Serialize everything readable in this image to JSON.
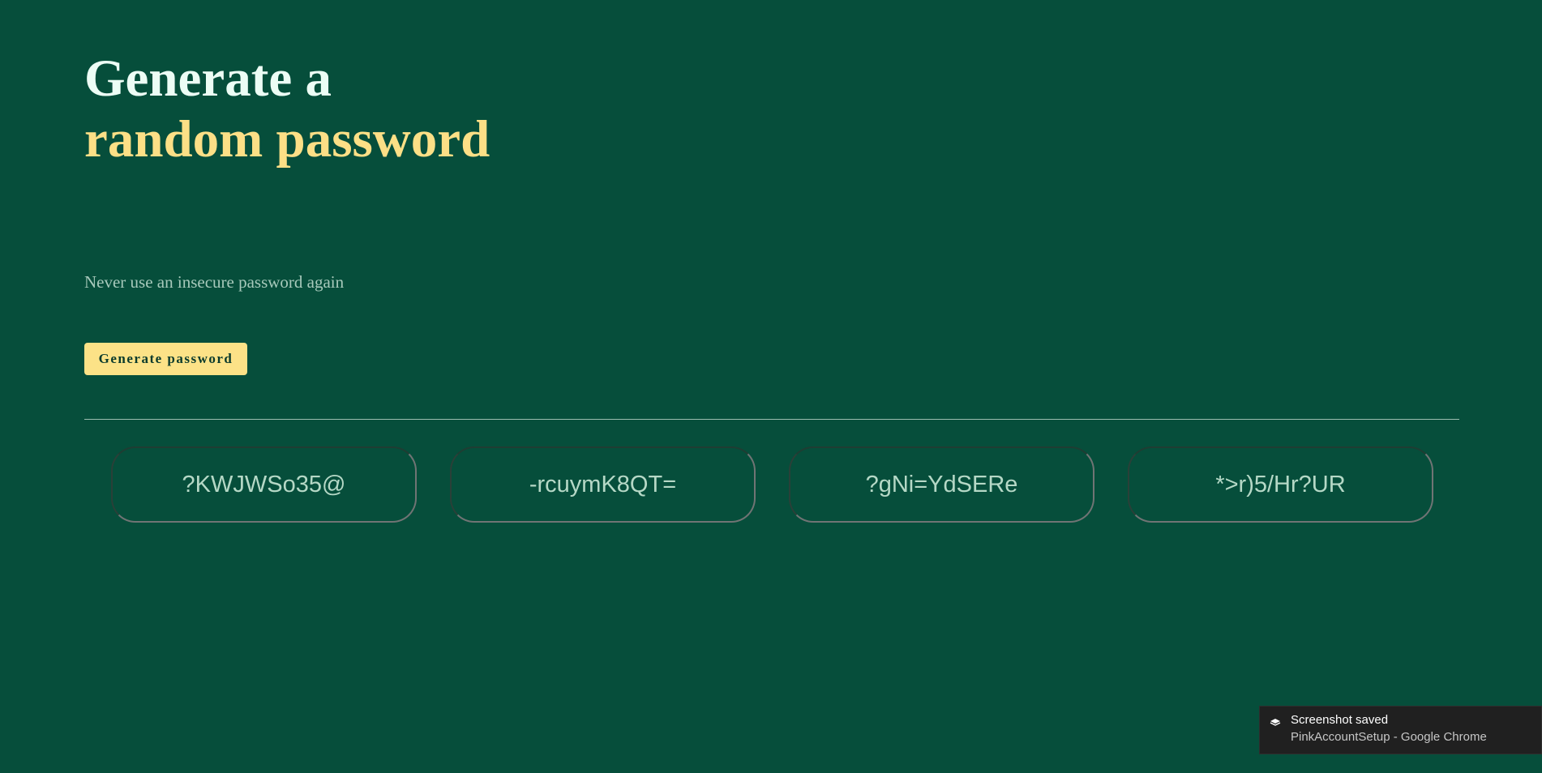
{
  "header": {
    "title_line1": "Generate a",
    "title_line2": "random password",
    "subtitle": "Never use an insecure password again"
  },
  "actions": {
    "generate_label": "Generate password"
  },
  "passwords": [
    "?KWJWSo35@",
    "-rcuymK8QT=",
    "?gNi=YdSERe",
    "*>r)5/Hr?UR"
  ],
  "notification": {
    "icon": "screenshot-icon",
    "title": "Screenshot saved",
    "subtitle": "PinkAccountSetup - Google Chrome"
  },
  "colors": {
    "background": "#064e3b",
    "title": "#ecfdf5",
    "accent": "#fcdf86",
    "button": "#fce287",
    "password_text": "#b5d8c6",
    "subtitle": "#a7c9bb"
  }
}
